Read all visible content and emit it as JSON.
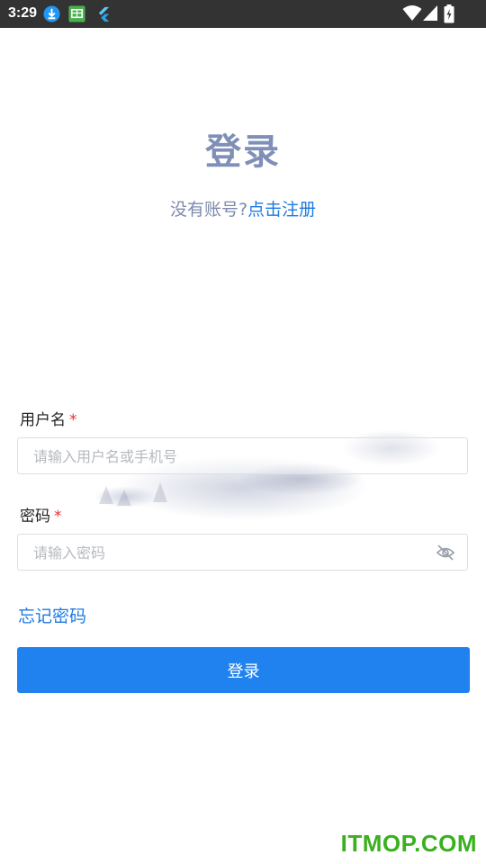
{
  "status_bar": {
    "time": "3:29",
    "icons": [
      "download-icon",
      "app-notification-icon",
      "flutter-icon",
      "wifi-icon",
      "signal-icon",
      "battery-icon"
    ]
  },
  "page": {
    "title": "登录",
    "no_account_text": "没有账号?",
    "register_link": "点击注册"
  },
  "form": {
    "username_label": "用户名",
    "username_required_mark": "*",
    "username_placeholder": "请输入用户名或手机号",
    "username_value": "",
    "password_label": "密码",
    "password_required_mark": "*",
    "password_placeholder": "请输入密码",
    "password_value": "",
    "password_toggle_icon": "eye-off-icon"
  },
  "forgot_password": "忘记密码",
  "login_button": "登录",
  "watermark": "ITMOP.COM",
  "colors": {
    "accent": "#2082ef",
    "title": "#7f8fb7",
    "required": "#e33434",
    "status_bar": "#333333",
    "watermark": "#3bb01f"
  }
}
